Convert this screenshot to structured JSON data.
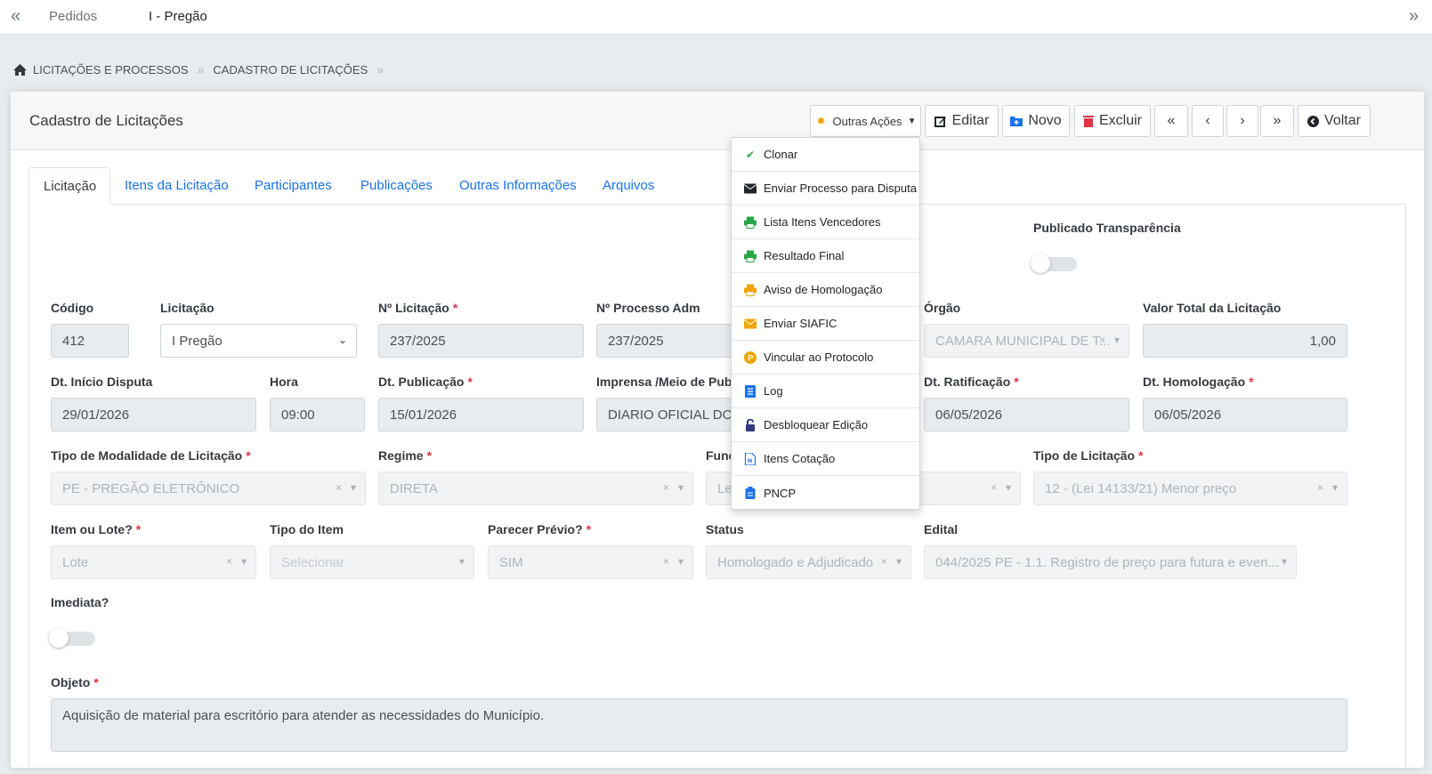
{
  "topbar": {
    "left_arrow": "«",
    "right_arrow": "»",
    "tab1": "Pedidos",
    "tab2": "I - Pregão"
  },
  "breadcrumb": {
    "item1": "LICITAÇÕES E PROCESSOS",
    "item2": "CADASTRO DE LICITAÇÕES"
  },
  "header": {
    "title": "Cadastro de Licitações",
    "outras_acoes": "Outras Ações",
    "editar": "Editar",
    "novo": "Novo",
    "excluir": "Excluir",
    "first": "«",
    "prev": "‹",
    "next": "›",
    "last": "»",
    "voltar": "Voltar"
  },
  "tabs": [
    "Licitação",
    "Itens da Licitação",
    "Participantes",
    "Publicações",
    "Outras Informações",
    "Arquivos"
  ],
  "dropdown": [
    {
      "label": "Clonar",
      "icon": "check-double-icon",
      "color": "#28a745"
    },
    {
      "label": "Enviar Processo para Disputa",
      "icon": "envelope-icon",
      "color": "#212529"
    },
    {
      "label": "Lista Itens Vencedores",
      "icon": "print-icon",
      "color": "#28a745"
    },
    {
      "label": "Resultado Final",
      "icon": "print-icon",
      "color": "#28a745"
    },
    {
      "label": "Aviso de Homologação",
      "icon": "print-icon",
      "color": "#f0a500"
    },
    {
      "label": "Enviar SIAFIC",
      "icon": "envelope-icon",
      "color": "#f0a500"
    },
    {
      "label": "Vincular ao Protocolo",
      "icon": "p-circle-icon",
      "color": "#f0a500"
    },
    {
      "label": "Log",
      "icon": "list-icon",
      "color": "#1a73e8"
    },
    {
      "label": "Desbloquear Edição",
      "icon": "unlock-icon",
      "color": "#343a80"
    },
    {
      "label": "Itens Cotação",
      "icon": "word-file-icon",
      "color": "#1a73e8"
    },
    {
      "label": "PNCP",
      "icon": "clipboard-icon",
      "color": "#1a73e8"
    }
  ],
  "form": {
    "publicado_label": "Publicado Transparência",
    "codigo_label": "Código",
    "codigo": "412",
    "licitacao_label": "Licitação",
    "licitacao": "I Pregão",
    "num_licitacao_label": "Nº Licitação",
    "num_licitacao": "237/2025",
    "num_processo_label": "Nº Processo Adm",
    "num_processo": "237/2025",
    "orgao_label": "Órgão",
    "orgao": "CAMARA MUNICIPAL DE T...",
    "valor_label": "Valor Total da Licitação",
    "valor": "1,00",
    "dt_inicio_label": "Dt. Início Disputa",
    "dt_inicio": "29/01/2026",
    "hora_label": "Hora",
    "hora": "09:00",
    "dt_pub_label": "Dt. Publicação",
    "dt_pub": "15/01/2026",
    "imprensa_label": "Imprensa /Meio de Publ",
    "imprensa": "DIARIO OFICIAL DOS M",
    "dt_ratif_label": "Dt. Ratificação",
    "dt_ratif": "06/05/2026",
    "dt_homol_label": "Dt. Homologação",
    "dt_homol": "06/05/2026",
    "modalidade_label": "Tipo de Modalidade de Licitação",
    "modalidade": "PE - PREGÃO ELETRÔNICO",
    "regime_label": "Regime",
    "regime": "DIRETA",
    "func_label": "Func",
    "func": "Le",
    "tipo_lic_label": "Tipo de Licitação",
    "tipo_lic": "12 - (Lei 14133/21) Menor preço",
    "item_lote_label": "Item ou Lote?",
    "item_lote": "Lote",
    "tipo_item_label": "Tipo do Item",
    "tipo_item": "Selecionar",
    "parecer_label": "Parecer Prévio?",
    "parecer": "SIM",
    "status_label": "Status",
    "status": "Homologado e Adjudicado",
    "edital_label": "Edital",
    "edital": "044/2025 PE - 1.1. Registro de preço para futura e even...",
    "imediata_label": "Imediata?",
    "objeto_label": "Objeto",
    "objeto": "Aquisição de material para escritório para atender as necessidades do Município.",
    "required_mark": "*",
    "clear_mark": "×",
    "caret": "▾"
  }
}
